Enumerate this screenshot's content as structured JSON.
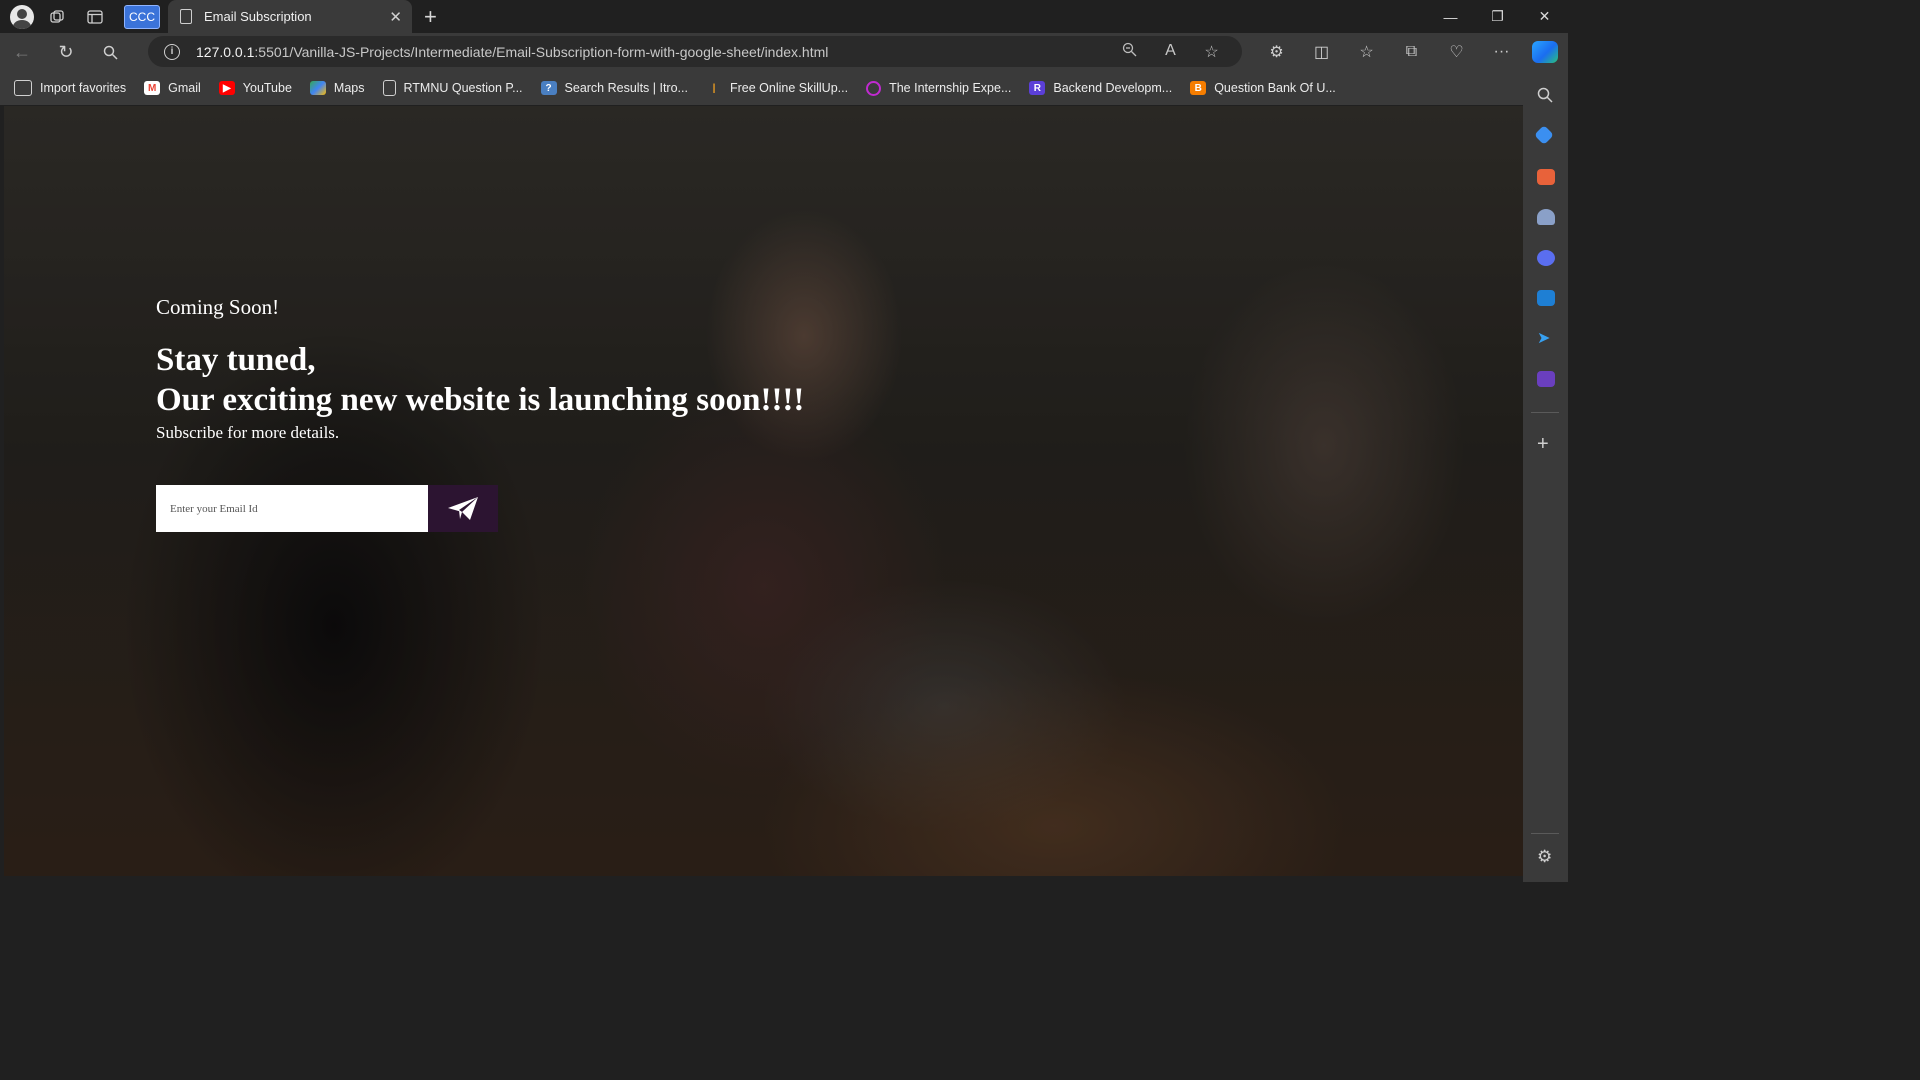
{
  "browser": {
    "badge": "CCC",
    "tab_title": "Email Subscription",
    "url_host": "127.0.0.1",
    "url_rest": ":5501/Vanilla-JS-Projects/Intermediate/Email-Subscription-form-with-google-sheet/index.html"
  },
  "favorites": [
    {
      "label": "Import favorites",
      "icon": "import-icon",
      "color": "#3a3a3a"
    },
    {
      "label": "Gmail",
      "icon": "gmail-icon",
      "color": "#ea4335"
    },
    {
      "label": "YouTube",
      "icon": "youtube-icon",
      "color": "#ff0000"
    },
    {
      "label": "Maps",
      "icon": "maps-icon",
      "color": "#34a853"
    },
    {
      "label": "RTMNU Question P...",
      "icon": "page-icon",
      "color": "#3a3a3a"
    },
    {
      "label": "Search Results | Itro...",
      "icon": "search-results-icon",
      "color": "#4a7fc1"
    },
    {
      "label": "Free Online SkillUp...",
      "icon": "skillup-icon",
      "color": "#f0a020"
    },
    {
      "label": "The Internship Expe...",
      "icon": "internship-icon",
      "color": "#c02ad0"
    },
    {
      "label": "Backend Developm...",
      "icon": "backend-icon",
      "color": "#5b3fd8"
    },
    {
      "label": "Question Bank Of U...",
      "icon": "blogger-icon",
      "color": "#f57d00"
    }
  ],
  "page": {
    "coming_soon": "Coming Soon!",
    "headline_line1": "Stay tuned,",
    "headline_line2": "Our exciting new website is launching soon!!!!",
    "subtitle": "Subscribe for more details.",
    "email_placeholder": "Enter your Email Id",
    "submit_icon": "paper-plane-icon",
    "submit_color": "#2c1431"
  }
}
